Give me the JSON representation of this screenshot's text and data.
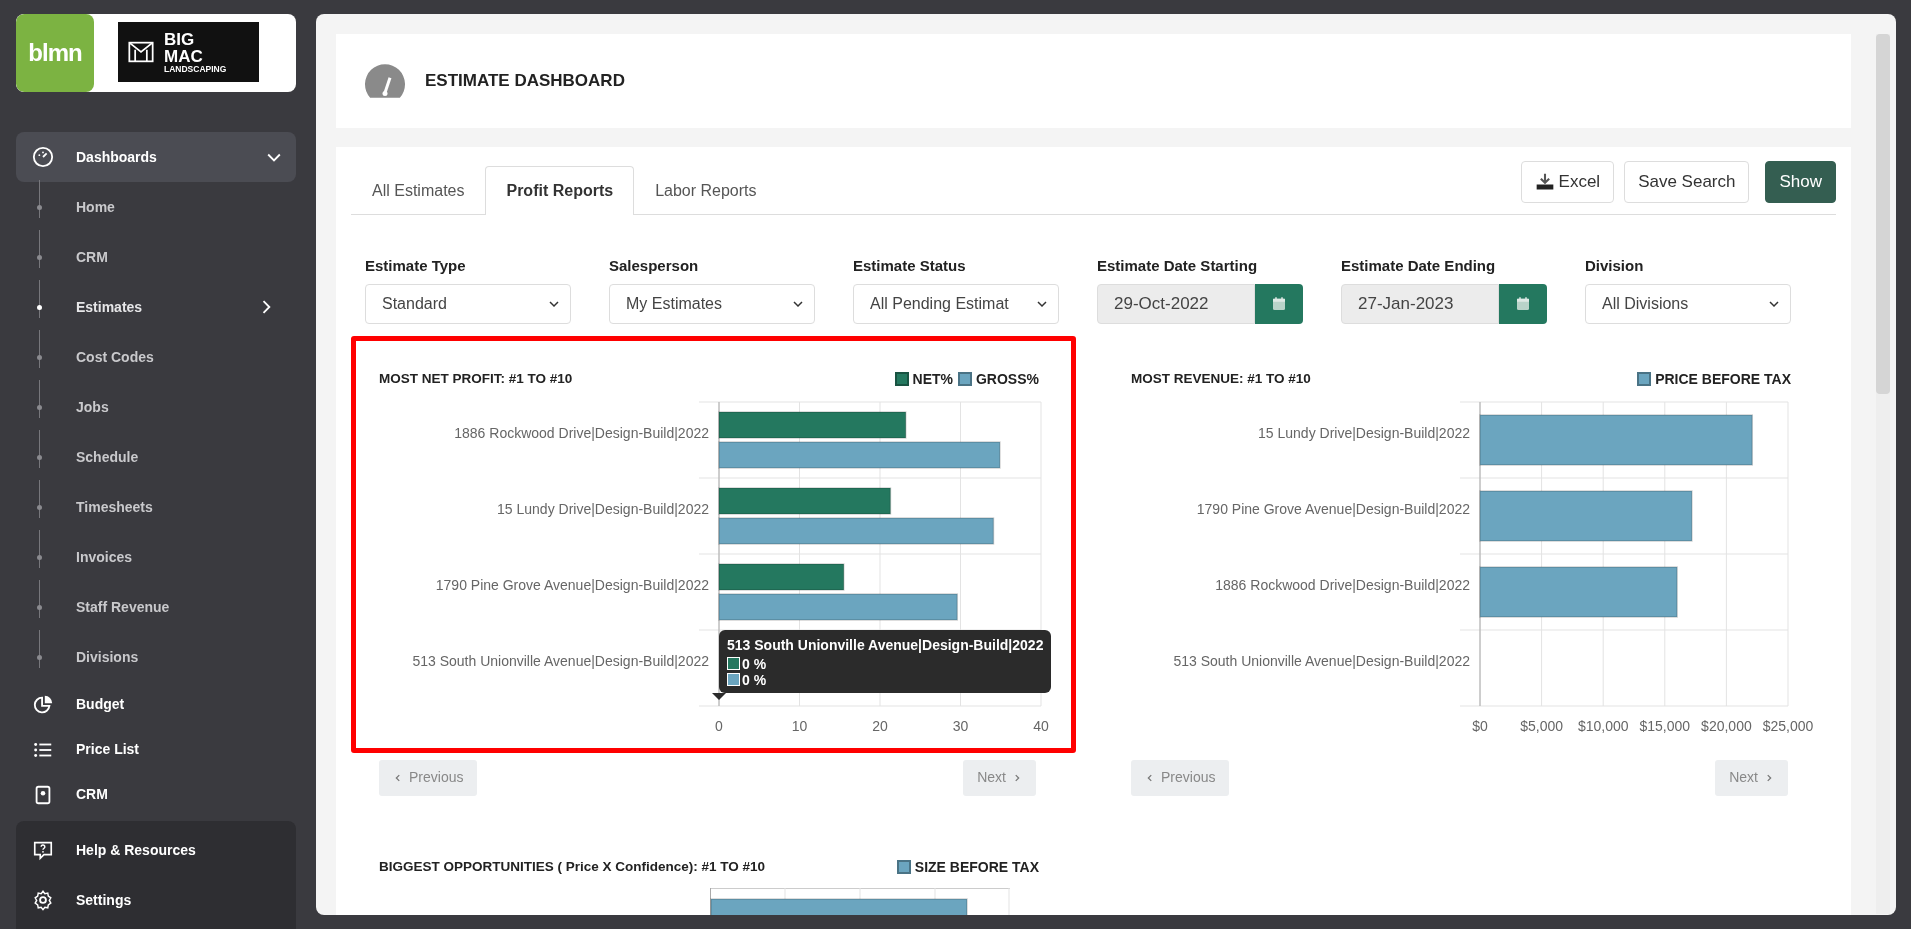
{
  "logo": {
    "brand": "blmn",
    "company_lines": [
      "BIG",
      "MAC",
      "LANDSCAPING"
    ]
  },
  "sidebar": {
    "items": [
      {
        "label": "Dashboards",
        "selected": true,
        "expanded": true,
        "children": [
          {
            "label": "Home",
            "selected": false,
            "has_submenu": false
          },
          {
            "label": "CRM",
            "selected": false,
            "has_submenu": false
          },
          {
            "label": "Estimates",
            "selected": true,
            "has_submenu": true
          },
          {
            "label": "Cost Codes",
            "selected": false,
            "has_submenu": false
          },
          {
            "label": "Jobs",
            "selected": false,
            "has_submenu": false
          },
          {
            "label": "Schedule",
            "selected": false,
            "has_submenu": false
          },
          {
            "label": "Timesheets",
            "selected": false,
            "has_submenu": false
          },
          {
            "label": "Invoices",
            "selected": false,
            "has_submenu": false
          },
          {
            "label": "Staff Revenue",
            "selected": false,
            "has_submenu": false
          },
          {
            "label": "Divisions",
            "selected": false,
            "has_submenu": false
          }
        ]
      },
      {
        "label": "Budget",
        "selected": false
      },
      {
        "label": "Price List",
        "selected": false
      },
      {
        "label": "CRM",
        "selected": false
      }
    ],
    "footer": [
      {
        "label": "Help & Resources"
      },
      {
        "label": "Settings"
      }
    ]
  },
  "header": {
    "title": "ESTIMATE DASHBOARD"
  },
  "tabs": [
    {
      "label": "All Estimates",
      "selected": false
    },
    {
      "label": "Profit Reports",
      "selected": true
    },
    {
      "label": "Labor Reports",
      "selected": false
    }
  ],
  "actions": [
    {
      "label": "Excel",
      "kind": "download"
    },
    {
      "label": "Save Search",
      "kind": "outline"
    },
    {
      "label": "Show",
      "kind": "primary"
    }
  ],
  "filters": [
    {
      "label": "Estimate Type",
      "kind": "select",
      "value": "Standard"
    },
    {
      "label": "Salesperson",
      "kind": "select",
      "value": "My Estimates"
    },
    {
      "label": "Estimate Status",
      "kind": "select",
      "value": "All Pending Estimat"
    },
    {
      "label": "Estimate Date Starting",
      "kind": "date",
      "value": "29-Oct-2022"
    },
    {
      "label": "Estimate Date Ending",
      "kind": "date",
      "value": "27-Jan-2023"
    },
    {
      "label": "Division",
      "kind": "select",
      "value": "All Divisions"
    }
  ],
  "charts": [
    {
      "title": "MOST NET PROFIT: #1 TO #10",
      "highlighted": true,
      "chart_data": {
        "type": "bar",
        "orientation": "horizontal",
        "grid": true,
        "categories": [
          "1886 Rockwood Drive|Design-Build|2022",
          "15 Lundy Drive|Design-Build|2022",
          "1790 Pine Grove Avenue|Design-Build|2022",
          "513 South Unionville Avenue|Design-Build|2022"
        ],
        "series": [
          {
            "name": "NET%",
            "color": "#24785f",
            "values": [
              23.2,
              21.3,
              15.5,
              0
            ]
          },
          {
            "name": "GROSS%",
            "color": "#6ba5bf",
            "values": [
              34.9,
              34.1,
              29.6,
              0
            ]
          }
        ],
        "xlim": [
          0,
          40
        ],
        "xticks": [
          0,
          10,
          20,
          30,
          40
        ]
      },
      "tooltip": {
        "title": "513 South Unionville Avenue|Design-Build|2022",
        "rows": [
          {
            "color": "#24785f",
            "value": "0 %"
          },
          {
            "color": "#6ba5bf",
            "value": "0 %"
          }
        ]
      },
      "pager": {
        "previous": "Previous",
        "next": "Next"
      }
    },
    {
      "title": "MOST REVENUE: #1 TO #10",
      "chart_data": {
        "type": "bar",
        "orientation": "horizontal",
        "grid": true,
        "categories": [
          "15 Lundy Drive|Design-Build|2022",
          "1790 Pine Grove Avenue|Design-Build|2022",
          "1886 Rockwood Drive|Design-Build|2022",
          "513 South Unionville Avenue|Design-Build|2022"
        ],
        "series": [
          {
            "name": "PRICE BEFORE TAX",
            "color": "#6ba5bf",
            "values": [
              22100,
              17200,
              16000,
              0
            ]
          }
        ],
        "xlim": [
          0,
          25000
        ],
        "xticks": [
          {
            "value": 0,
            "label": "$0"
          },
          {
            "value": 5000,
            "label": "$5,000"
          },
          {
            "value": 10000,
            "label": "$10,000"
          },
          {
            "value": 15000,
            "label": "$15,000"
          },
          {
            "value": 20000,
            "label": "$20,000"
          },
          {
            "value": 25000,
            "label": "$25,000"
          }
        ]
      },
      "pager": {
        "previous": "Previous",
        "next": "Next"
      }
    },
    {
      "title": "BIGGEST OPPORTUNITIES ( Price X Confidence): #1 TO #10",
      "legend": [
        {
          "name": "SIZE BEFORE TAX",
          "color": "#6ba5bf"
        }
      ]
    }
  ]
}
